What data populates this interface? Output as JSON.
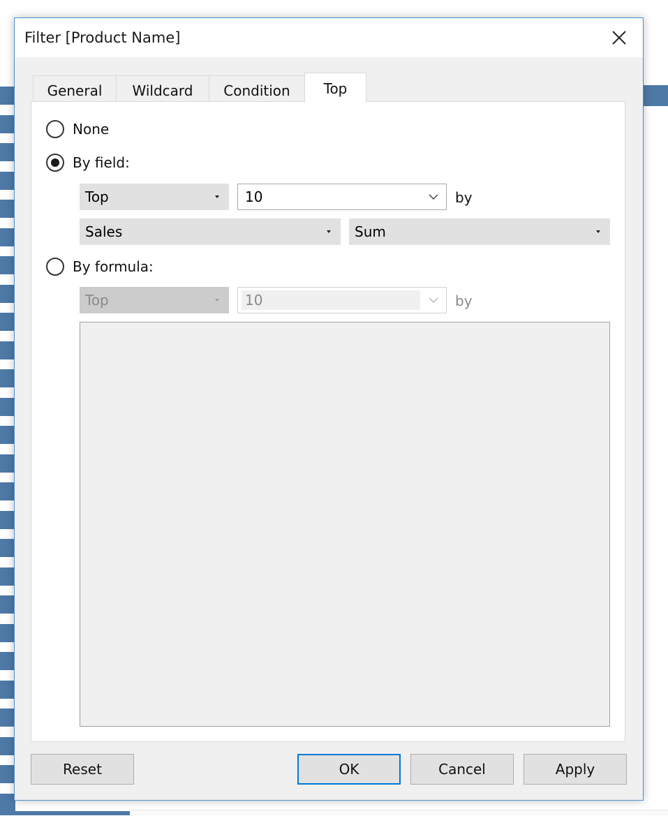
{
  "dialog": {
    "title": "Filter [Product Name]"
  },
  "tabs": [
    {
      "label": "General"
    },
    {
      "label": "Wildcard"
    },
    {
      "label": "Condition"
    },
    {
      "label": "Top"
    }
  ],
  "active_tab": "Top",
  "options": {
    "none_label": "None",
    "by_field_label": "By field:",
    "by_formula_label": "By formula:",
    "selected": "By field:"
  },
  "by_field": {
    "direction": "Top",
    "count": "10",
    "by_label": "by",
    "field": "Sales",
    "aggregation": "Sum"
  },
  "by_formula": {
    "direction": "Top",
    "count": "10",
    "by_label": "by",
    "formula": ""
  },
  "buttons": {
    "reset": "Reset",
    "ok": "OK",
    "cancel": "Cancel",
    "apply": "Apply"
  },
  "colors": {
    "accent": "#0078d7",
    "background_bars": "#4e79a7"
  }
}
